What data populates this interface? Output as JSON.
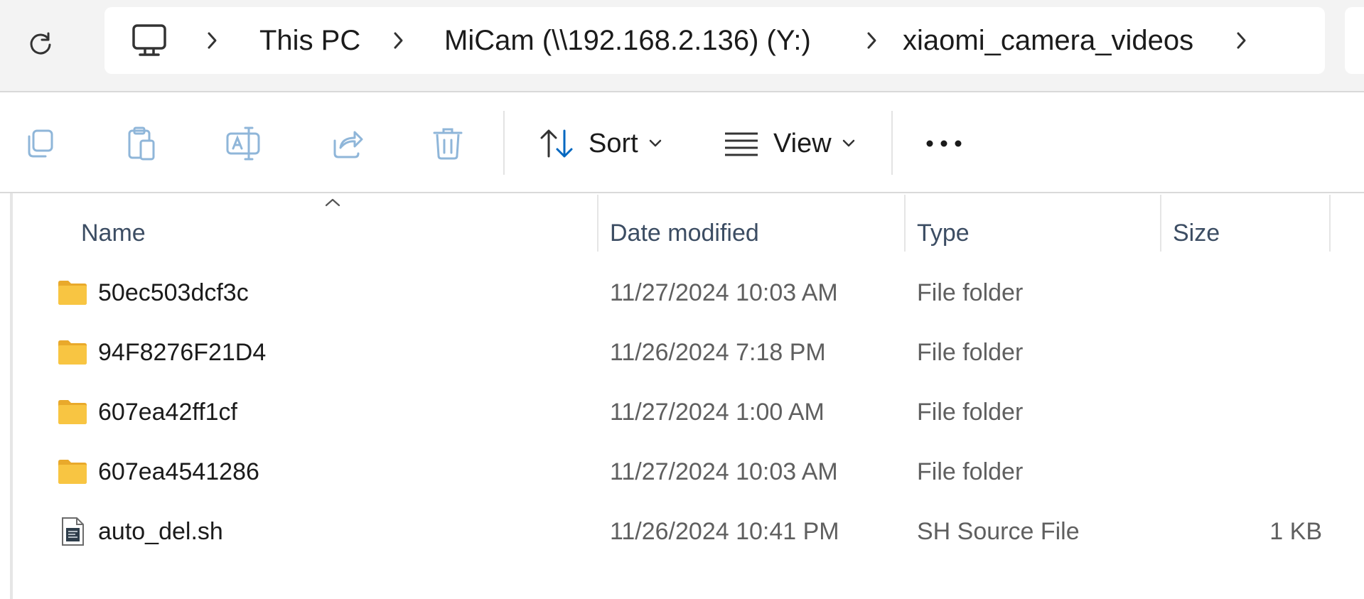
{
  "address": {
    "breadcrumbs": [
      {
        "label": "This PC"
      },
      {
        "label": "MiCam (\\\\192.168.2.136) (Y:)"
      },
      {
        "label": "xiaomi_camera_videos"
      }
    ]
  },
  "toolbar": {
    "sort_label": "Sort",
    "view_label": "View"
  },
  "columns": {
    "name": "Name",
    "date": "Date modified",
    "type": "Type",
    "size": "Size"
  },
  "files": [
    {
      "name": "50ec503dcf3c",
      "date": "11/27/2024 10:03 AM",
      "type": "File folder",
      "size": "",
      "icon": "folder-icon"
    },
    {
      "name": "94F8276F21D4",
      "date": "11/26/2024 7:18 PM",
      "type": "File folder",
      "size": "",
      "icon": "folder-icon"
    },
    {
      "name": "607ea42ff1cf",
      "date": "11/27/2024 1:00 AM",
      "type": "File folder",
      "size": "",
      "icon": "folder-icon"
    },
    {
      "name": "607ea4541286",
      "date": "11/27/2024 10:03 AM",
      "type": "File folder",
      "size": "",
      "icon": "folder-icon"
    },
    {
      "name": "auto_del.sh",
      "date": "11/26/2024 10:41 PM",
      "type": "SH Source File",
      "size": "1 KB",
      "icon": "script-file-icon"
    }
  ],
  "colors": {
    "accent": "#0067c0",
    "folder": "#f8c542",
    "disabled_icon": "#8fb6d9"
  }
}
